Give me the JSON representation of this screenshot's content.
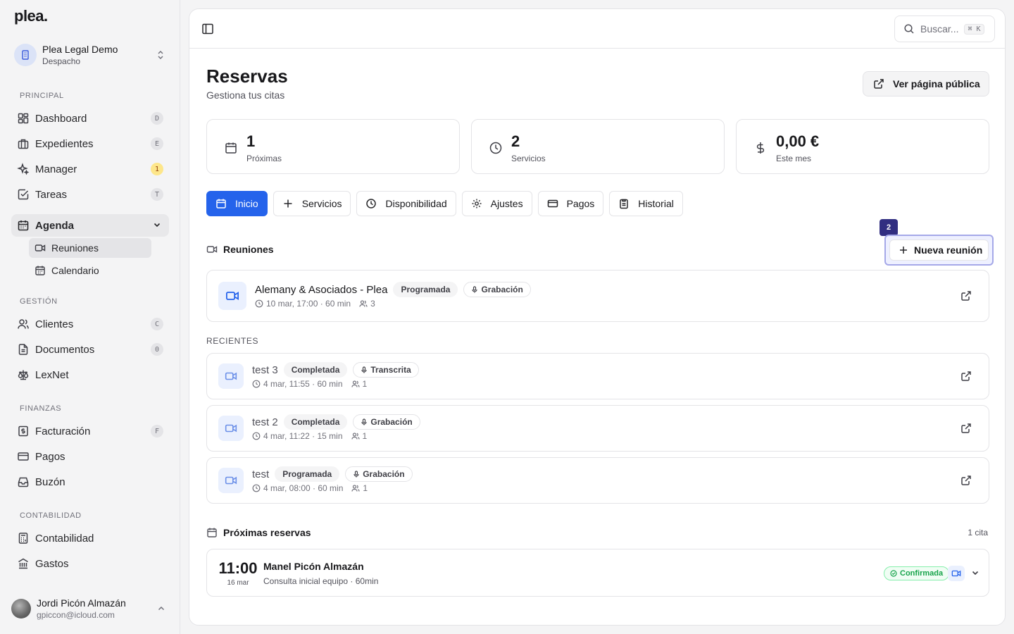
{
  "brand": {
    "logo": "plea.",
    "accent": "#2563eb"
  },
  "org": {
    "name": "Plea Legal Demo",
    "type": "Despacho"
  },
  "sidebar": {
    "sections": {
      "principal": "PRINCIPAL",
      "gestion": "GESTIÓN",
      "finanzas": "FINANZAS",
      "contabilidad": "CONTABILIDAD"
    },
    "items": {
      "dashboard": {
        "label": "Dashboard",
        "key": "D",
        "icon": "layout-dashboard-icon"
      },
      "expedientes": {
        "label": "Expedientes",
        "key": "E",
        "icon": "briefcase-icon"
      },
      "manager": {
        "label": "Manager",
        "key": "1",
        "icon": "sparkles-icon"
      },
      "tareas": {
        "label": "Tareas",
        "key": "T",
        "icon": "square-check-icon"
      },
      "agenda": {
        "label": "Agenda",
        "icon": "calendar-icon"
      },
      "reuniones": {
        "label": "Reuniones",
        "icon": "video-icon"
      },
      "calendario": {
        "label": "Calendario",
        "icon": "calendar-days-icon"
      },
      "clientes": {
        "label": "Clientes",
        "key": "C",
        "icon": "users-icon"
      },
      "documentos": {
        "label": "Documentos",
        "key": "0",
        "icon": "file-text-icon"
      },
      "lexnet": {
        "label": "LexNet",
        "icon": "scale-icon"
      },
      "facturacion": {
        "label": "Facturación",
        "key": "F",
        "icon": "receipt-icon"
      },
      "pagos": {
        "label": "Pagos",
        "icon": "credit-card-icon"
      },
      "buzon": {
        "label": "Buzón",
        "icon": "inbox-icon"
      },
      "contabilidad": {
        "label": "Contabilidad",
        "icon": "calculator-icon"
      },
      "gastos": {
        "label": "Gastos",
        "icon": "landmark-icon"
      }
    }
  },
  "user": {
    "name": "Jordi Picón Almazán",
    "email": "gpiccon@icloud.com"
  },
  "topbar": {
    "search_placeholder": "Buscar...",
    "search_kbd": "⌘ K"
  },
  "page": {
    "title": "Reservas",
    "subtitle": "Gestiona tus citas",
    "public_button": "Ver página pública"
  },
  "stats": [
    {
      "value": "1",
      "label": "Próximas",
      "icon": "calendar-icon"
    },
    {
      "value": "2",
      "label": "Servicios",
      "icon": "clock-icon"
    },
    {
      "value": "0,00 €",
      "label": "Este mes",
      "icon": "dollar-icon"
    }
  ],
  "tabs": [
    {
      "label": "Inicio",
      "active": true
    },
    {
      "label": "Servicios"
    },
    {
      "label": "Disponibilidad"
    },
    {
      "label": "Ajustes"
    },
    {
      "label": "Pagos"
    },
    {
      "label": "Historial"
    }
  ],
  "meetings": {
    "heading": "Reuniones",
    "new_button": "Nueva reunión",
    "badge": "2",
    "upcoming": {
      "title": "Alemany & Asociados - Plea",
      "status": "Programada",
      "tag": "Grabación",
      "when": "10 mar, 17:00 · 60 min",
      "attendees": "3"
    },
    "recent_label": "RECIENTES",
    "recent": [
      {
        "title": "test 3",
        "status": "Completada",
        "tag": "Transcrita",
        "when": "4 mar, 11:55 · 60 min",
        "attendees": "1"
      },
      {
        "title": "test 2",
        "status": "Completada",
        "tag": "Grabación",
        "when": "4 mar, 11:22 · 15 min",
        "attendees": "1"
      },
      {
        "title": "test",
        "status": "Programada",
        "tag": "Grabación",
        "when": "4 mar, 08:00 · 60 min",
        "attendees": "1"
      }
    ]
  },
  "bookings": {
    "heading": "Próximas reservas",
    "count": "1 cita",
    "items": [
      {
        "hour": "11:00",
        "day": "16 mar",
        "name": "Manel Picón Almazán",
        "desc": "Consulta inicial equipo · 60min",
        "status": "Confirmada"
      }
    ]
  }
}
